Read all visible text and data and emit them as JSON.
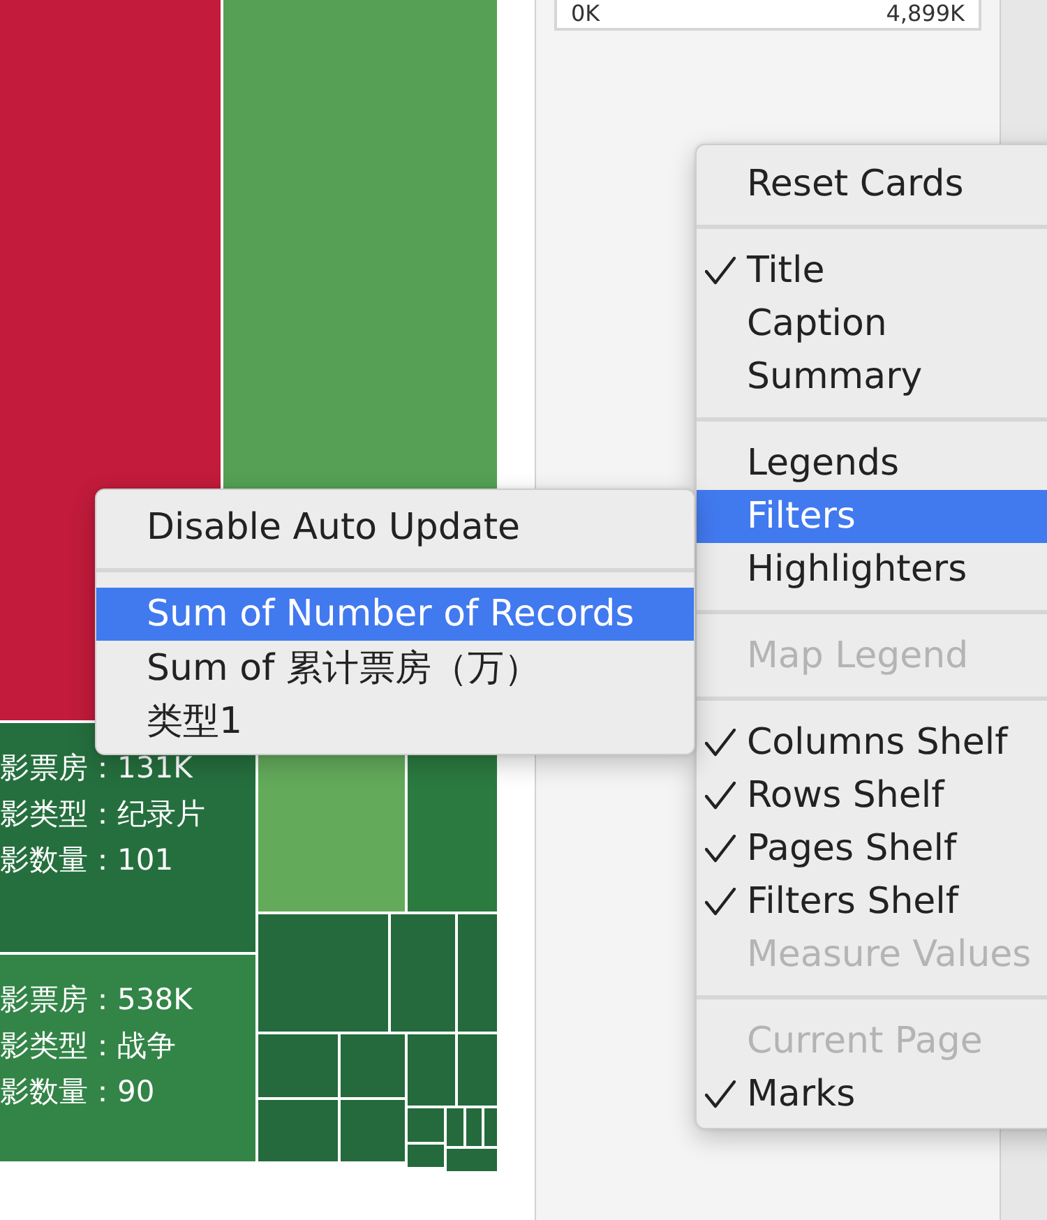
{
  "treemap": {
    "tiles": [
      {
        "color": "#c21b3b"
      },
      {
        "color": "#55a055"
      },
      {
        "color": "#256f3e",
        "lines": [
          "影票房：131K",
          "影类型：纪录片",
          "影数量：101"
        ]
      },
      {
        "color": "#338447",
        "lines": [
          "影票房：538K",
          "影类型：战争",
          "影数量：90"
        ]
      },
      {
        "color": "#63ab5b"
      },
      {
        "color": "#2b7a40"
      },
      {
        "color": "#246a3c"
      },
      {
        "color": "#246a3c"
      },
      {
        "color": "#246a3c"
      },
      {
        "color": "#246a3c"
      },
      {
        "color": "#246a3c"
      },
      {
        "color": "#246a3c"
      },
      {
        "color": "#246a3c"
      },
      {
        "color": "#246a3c"
      },
      {
        "color": "#246a3c"
      },
      {
        "color": "#246a3c"
      },
      {
        "color": "#246a3c"
      },
      {
        "color": "#246a3c"
      },
      {
        "color": "#246a3c"
      },
      {
        "color": "#246a3c"
      },
      {
        "color": "#246a3c"
      }
    ]
  },
  "color_legend": {
    "min": "0K",
    "max": "4,899K"
  },
  "context_menu": {
    "sections": [
      {
        "items": [
          {
            "label": "Reset Cards",
            "checked": false,
            "disabled": false,
            "selected": false
          }
        ]
      },
      {
        "items": [
          {
            "label": "Title",
            "checked": true,
            "disabled": false,
            "selected": false
          },
          {
            "label": "Caption",
            "checked": false,
            "disabled": false,
            "selected": false
          },
          {
            "label": "Summary",
            "checked": false,
            "disabled": false,
            "selected": false
          }
        ]
      },
      {
        "items": [
          {
            "label": "Legends",
            "checked": false,
            "disabled": false,
            "selected": false
          },
          {
            "label": "Filters",
            "checked": false,
            "disabled": false,
            "selected": true
          },
          {
            "label": "Highlighters",
            "checked": false,
            "disabled": false,
            "selected": false
          }
        ]
      },
      {
        "items": [
          {
            "label": "Map Legend",
            "checked": false,
            "disabled": true,
            "selected": false
          }
        ]
      },
      {
        "items": [
          {
            "label": "Columns Shelf",
            "checked": true,
            "disabled": false,
            "selected": false
          },
          {
            "label": "Rows Shelf",
            "checked": true,
            "disabled": false,
            "selected": false
          },
          {
            "label": "Pages Shelf",
            "checked": true,
            "disabled": false,
            "selected": false
          },
          {
            "label": "Filters Shelf",
            "checked": true,
            "disabled": false,
            "selected": false
          },
          {
            "label": "Measure Values",
            "checked": false,
            "disabled": true,
            "selected": false
          }
        ]
      },
      {
        "items": [
          {
            "label": "Current Page",
            "checked": false,
            "disabled": true,
            "selected": false
          },
          {
            "label": "Marks",
            "checked": true,
            "disabled": false,
            "selected": false
          }
        ]
      }
    ]
  },
  "submenu": {
    "sections": [
      {
        "items": [
          {
            "label": "Disable Auto Update",
            "selected": false
          }
        ]
      },
      {
        "items": [
          {
            "label": "Sum of Number of Records",
            "selected": true
          },
          {
            "label": "Sum of 累计票房（万）",
            "selected": false
          },
          {
            "label": "类型1",
            "selected": false
          }
        ]
      }
    ]
  }
}
